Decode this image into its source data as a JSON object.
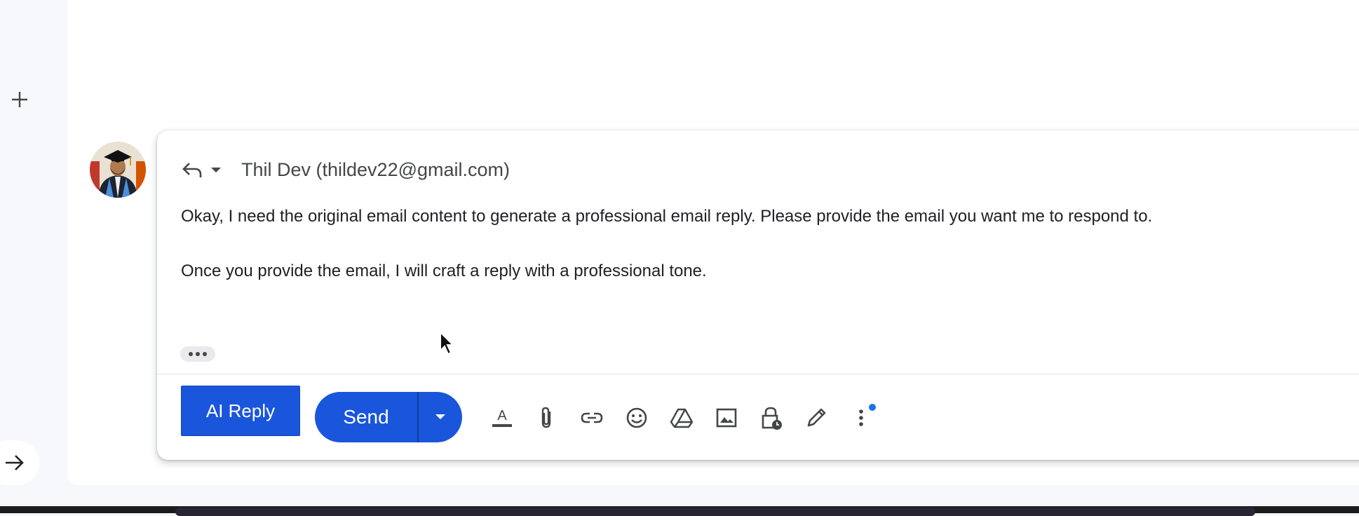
{
  "left_rail": {
    "plus_icon": "plus-icon",
    "arrow_icon": "arrow-right-icon"
  },
  "avatar": {
    "icon": "user-avatar"
  },
  "compose": {
    "reply_type_icon": "reply-icon",
    "reply_type_menu_icon": "caret-down-icon",
    "recipient": "Thil Dev (thildev22@gmail.com)",
    "body": [
      "Okay, I need the original email content to generate a professional email reply. Please provide the email you want me to respond to.",
      "Once you provide the email, I will craft a reply with a professional tone."
    ],
    "trimmed_icon": "ellipsis-icon"
  },
  "toolbar": {
    "ai_reply_label": "AI Reply",
    "send_label": "Send",
    "send_options_icon": "caret-down-icon",
    "tools": [
      "formatting-options-icon",
      "attach-file-icon",
      "insert-link-icon",
      "insert-emoji-icon",
      "google-drive-icon",
      "insert-photo-icon",
      "confidential-mode-icon",
      "signature-icon",
      "more-options-icon"
    ]
  },
  "colors": {
    "accent_blue": "#1a56db",
    "notification_dot": "#1a73e8",
    "text_primary": "#202124",
    "text_secondary": "#444746",
    "icon_grey": "#444746"
  }
}
